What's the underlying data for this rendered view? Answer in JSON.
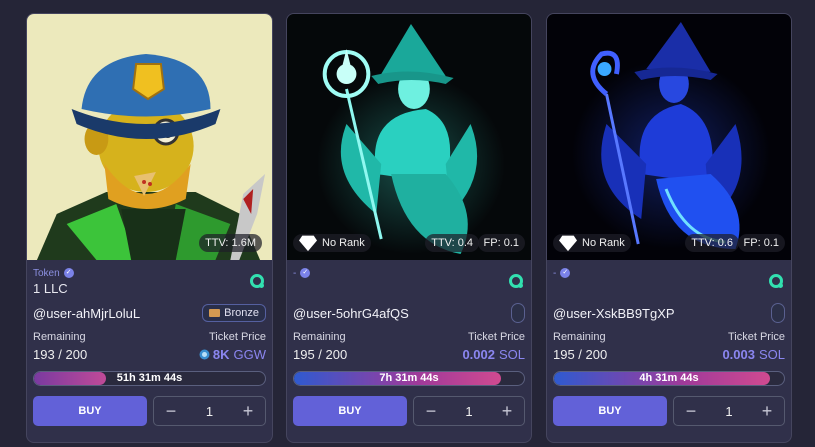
{
  "cards": [
    {
      "category": "Token",
      "name": "1 LLC",
      "user": "@user-ahMjrLoluL",
      "badge": "Bronze",
      "ttv": "TTV: 1.6M",
      "remaining_label": "Remaining",
      "remaining": "193 / 200",
      "price_label": "Ticket Price",
      "price_value": "8K",
      "price_unit": "GGW",
      "progress": 0.31,
      "timer": "51h 31m 44s",
      "buy_label": "BUY",
      "quantity": "1"
    },
    {
      "category": "-",
      "name": "",
      "user": "@user-5ohrG4afQS",
      "rank": "No Rank",
      "ttv": "TTV: 0.4",
      "fp": "FP: 0.1",
      "remaining_label": "Remaining",
      "remaining": "195 / 200",
      "price_label": "Ticket Price",
      "price_value": "0.002",
      "price_unit": "SOL",
      "progress": 0.9,
      "timer": "7h 31m 44s",
      "buy_label": "BUY",
      "quantity": "1"
    },
    {
      "category": "-",
      "name": "",
      "user": "@user-XskBB9TgXP",
      "rank": "No Rank",
      "ttv": "TTV: 0.6",
      "fp": "FP: 0.1",
      "remaining_label": "Remaining",
      "remaining": "195 / 200",
      "price_label": "Ticket Price",
      "price_value": "0.003",
      "price_unit": "SOL",
      "progress": 0.94,
      "timer": "4h 31m 44s",
      "buy_label": "BUY",
      "quantity": "1"
    }
  ],
  "colors": {
    "accent": "#6261d8",
    "price": "#8b86f0",
    "ring": "#32e0b0",
    "card_bg": "#30304a"
  },
  "icons": {
    "verify": "verified-check-icon",
    "ring": "circle-logo-icon",
    "rank": "diamond-icon",
    "coin": "coin-icon",
    "minus": "minus-icon",
    "plus": "plus-icon"
  }
}
